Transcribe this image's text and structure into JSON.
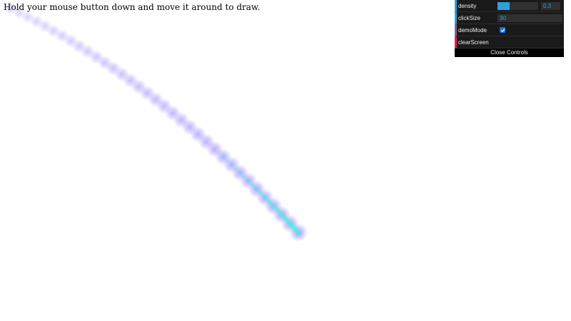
{
  "instructions": "Hold your mouse button down and move it around to draw.",
  "controls": {
    "density": {
      "label": "density",
      "value": "0.3",
      "fraction": 0.3
    },
    "clickSize": {
      "label": "clickSize",
      "value": "30"
    },
    "demoMode": {
      "label": "demoMode",
      "checked": true
    },
    "clearScreen": {
      "label": "clearScreen"
    },
    "close_label": "Close Controls"
  },
  "colors": {
    "number_accent": "#2fa1d6",
    "boolean_accent": "#806787",
    "function_accent": "#e61d5f",
    "stroke_outer": "#6a5cff",
    "stroke_inner": "#40f0c8"
  }
}
